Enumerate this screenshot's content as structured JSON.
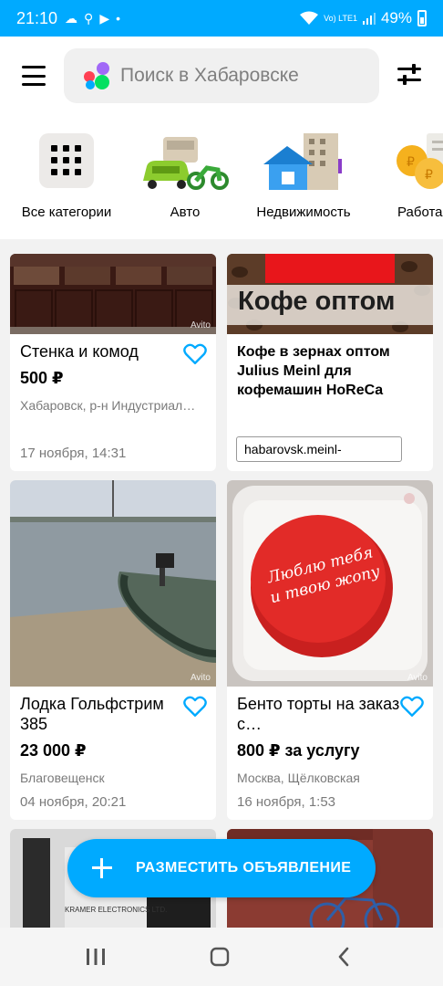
{
  "statusbar": {
    "time": "21:10",
    "network_label": "Vo) LTE1",
    "battery": "49%"
  },
  "header": {
    "search_placeholder": "Поиск в Хабаровске"
  },
  "categories": [
    {
      "label": "Все категории"
    },
    {
      "label": "Авто"
    },
    {
      "label": "Недвижимость"
    },
    {
      "label": "Работа"
    }
  ],
  "listings": [
    {
      "title": "Стенка и комод",
      "price": "500 ₽",
      "location": "Хабаровск, р-н Индустриал…",
      "date": "17 ноября, 14:31",
      "watermark": "Avito"
    },
    {
      "ad_image_text": "Кофе оптом",
      "title": "Кофе в зернах оптом Julius Meinl для кофемашин HoReCa",
      "url": "habarovsk.meinl-"
    },
    {
      "title": "Лодка Гольфстрим 385",
      "price": "23 000 ₽",
      "location": "Благовещенск",
      "date": "04 ноября, 20:21",
      "watermark": "Avito"
    },
    {
      "title": "Бенто торты на заказ с…",
      "price": "800 ₽ за услугу",
      "location": "Москва, Щёлковская",
      "date": "16 ноября, 1:53",
      "cake_text": "Люблю тебя и твою жопу",
      "watermark": "Avito"
    },
    {
      "image_text": "KRAMER ELECTRONICS LTD."
    }
  ],
  "fab": {
    "label": "РАЗМЕСТИТЬ ОБЪЯВЛЕНИЕ"
  },
  "colors": {
    "accent": "#00aaff",
    "heart": "#00aaff",
    "price": "#000000",
    "muted": "#7a7a7a"
  }
}
